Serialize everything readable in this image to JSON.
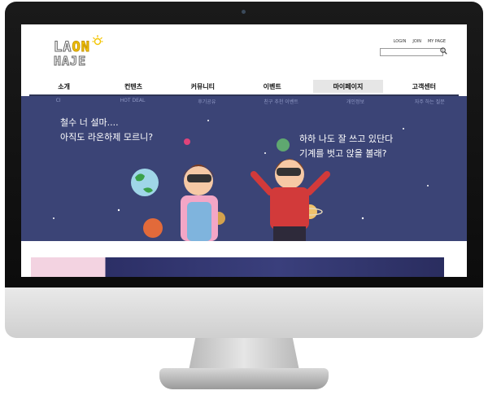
{
  "brand": {
    "line1": "LA",
    "line1_on": "ON",
    "line2": "HAJE"
  },
  "utility_links": [
    "LOGIN",
    "JOIN",
    "MY PAGE"
  ],
  "search": {
    "placeholder": ""
  },
  "nav": [
    {
      "label": "소개"
    },
    {
      "label": "컨텐츠"
    },
    {
      "label": "커뮤니티"
    },
    {
      "label": "이벤트"
    },
    {
      "label": "마이페이지",
      "active": true
    },
    {
      "label": "고객센터"
    }
  ],
  "subnav": [
    "CI",
    "HOT DEAL",
    "후기공유",
    "친구 추천 이벤트",
    "개인정보",
    "자주 하는 질문"
  ],
  "banner": {
    "text_left_1": "철수 너 설마....",
    "text_left_2": "아직도 라온하제 모르니?",
    "text_right_1": "하하 나도 잘 쓰고 있단다",
    "text_right_2": "기계를 벗고 앉을 볼래?"
  },
  "colors": {
    "banner_bg": "#3b4476",
    "nav_line": "#2e3555",
    "logo_accent": "#f3c400"
  }
}
